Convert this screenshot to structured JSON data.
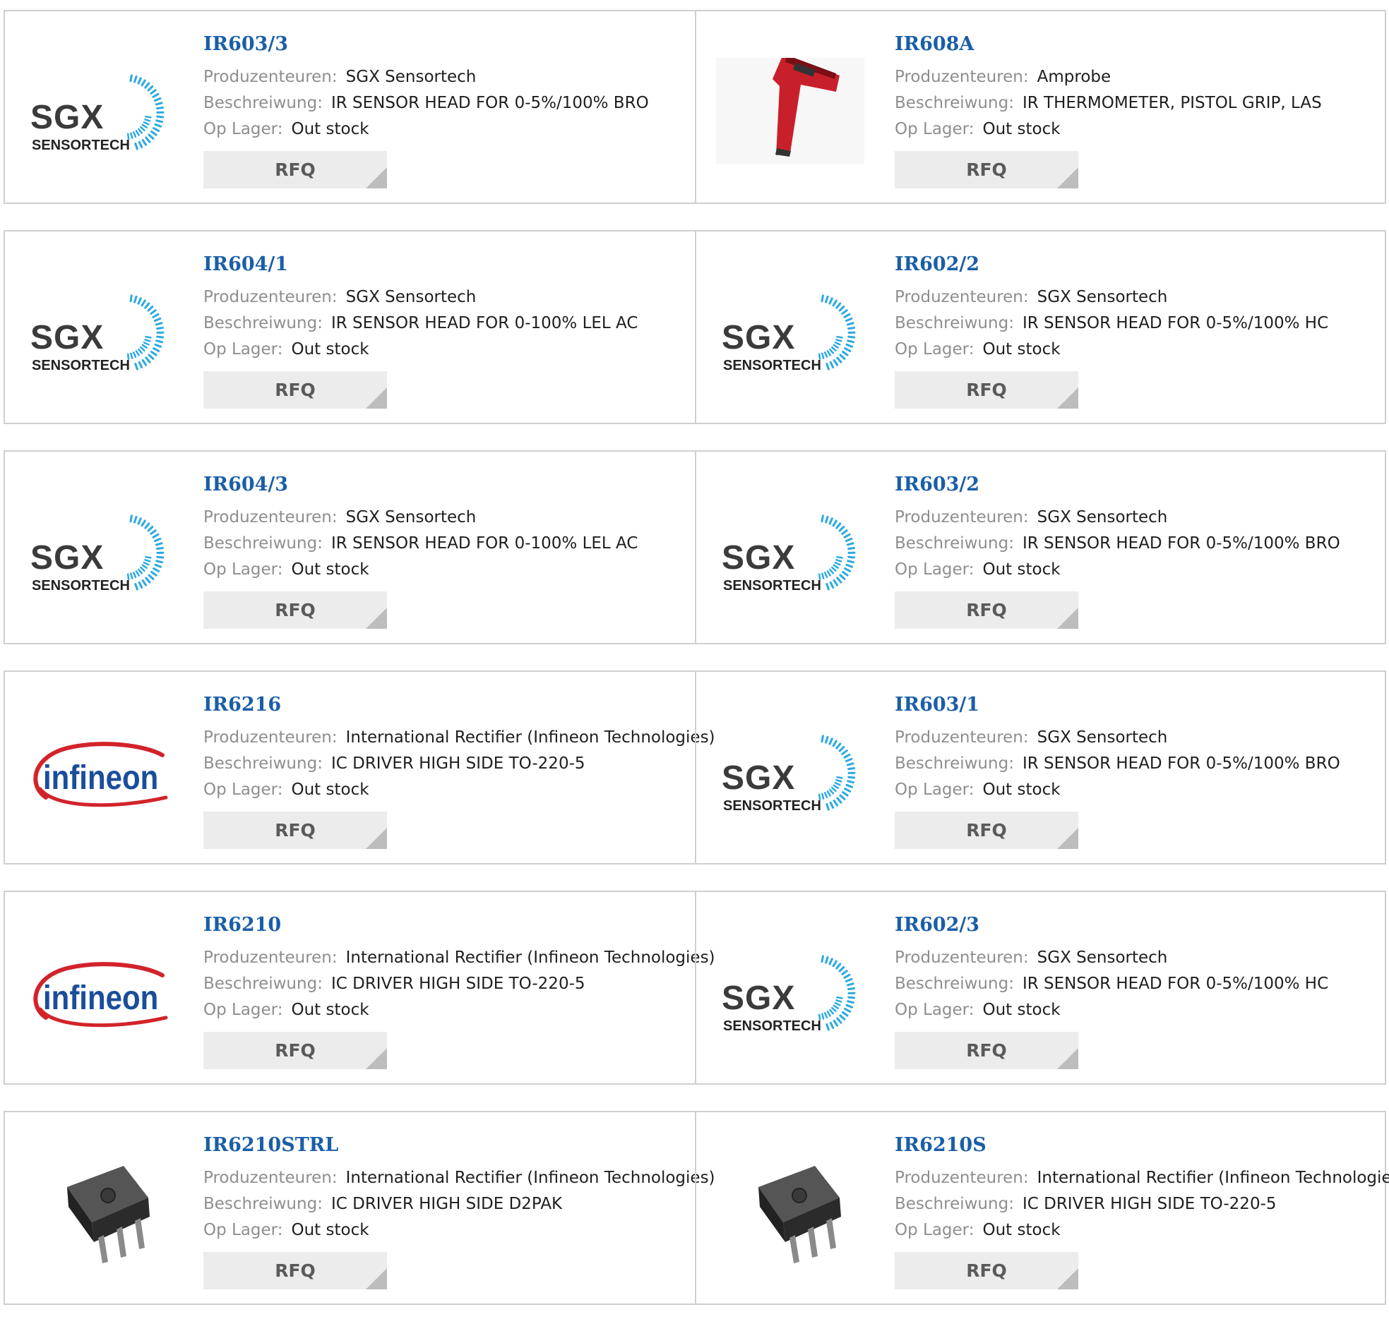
{
  "labels": {
    "manufacturer": "Produzenteuren:",
    "description": "Beschreiwung:",
    "stock": "Op Lager:",
    "rfq": "RFQ"
  },
  "logos": {
    "sgx_line1": "SGX",
    "sgx_line2": "SENSORTECH",
    "infineon": "infineon"
  },
  "colors": {
    "part_number": "#1a5ea8",
    "label_gray": "#8e8e8e",
    "rfq_bg": "#ececec",
    "infineon_red": "#d2232a",
    "infineon_blue": "#1a4d9c",
    "sgx_gray": "#3b3b3b",
    "sgx_cyan": "#2aa9e0"
  },
  "rows": [
    [
      {
        "part": "IR603/3",
        "manufacturer": "SGX Sensortech",
        "description": "IR SENSOR HEAD FOR 0-5%/100% BRO",
        "stock": "Out stock",
        "logo": "sgx-sensortech-logo"
      },
      {
        "part": "IR608A",
        "manufacturer": "Amprobe",
        "description": "IR THERMOMETER, PISTOL GRIP, LAS",
        "stock": "Out stock",
        "logo": "ir-thermometer-photo"
      }
    ],
    [
      {
        "part": "IR604/1",
        "manufacturer": "SGX Sensortech",
        "description": "IR SENSOR HEAD FOR 0-100% LEL AC",
        "stock": "Out stock",
        "logo": "sgx-sensortech-logo"
      },
      {
        "part": "IR602/2",
        "manufacturer": "SGX Sensortech",
        "description": "IR SENSOR HEAD FOR 0-5%/100% HC",
        "stock": "Out stock",
        "logo": "sgx-sensortech-logo"
      }
    ],
    [
      {
        "part": "IR604/3",
        "manufacturer": "SGX Sensortech",
        "description": "IR SENSOR HEAD FOR 0-100% LEL AC",
        "stock": "Out stock",
        "logo": "sgx-sensortech-logo"
      },
      {
        "part": "IR603/2",
        "manufacturer": "SGX Sensortech",
        "description": "IR SENSOR HEAD FOR 0-5%/100% BRO",
        "stock": "Out stock",
        "logo": "sgx-sensortech-logo"
      }
    ],
    [
      {
        "part": "IR6216",
        "manufacturer": "International Rectifier (Infineon Technologies)",
        "description": "IC DRIVER HIGH SIDE TO-220-5",
        "stock": "Out stock",
        "logo": "infineon-logo"
      },
      {
        "part": "IR603/1",
        "manufacturer": "SGX Sensortech",
        "description": "IR SENSOR HEAD FOR 0-5%/100% BRO",
        "stock": "Out stock",
        "logo": "sgx-sensortech-logo"
      }
    ],
    [
      {
        "part": "IR6210",
        "manufacturer": "International Rectifier (Infineon Technologies)",
        "description": "IC DRIVER HIGH SIDE TO-220-5",
        "stock": "Out stock",
        "logo": "infineon-logo"
      },
      {
        "part": "IR602/3",
        "manufacturer": "SGX Sensortech",
        "description": "IR SENSOR HEAD FOR 0-5%/100% HC",
        "stock": "Out stock",
        "logo": "sgx-sensortech-logo"
      }
    ],
    [
      {
        "part": "IR6210STRL",
        "manufacturer": "International Rectifier (Infineon Technologies)",
        "description": "IC DRIVER HIGH SIDE D2PAK",
        "stock": "Out stock",
        "logo": "d2pak-chip-photo"
      },
      {
        "part": "IR6210S",
        "manufacturer": "International Rectifier (Infineon Technologies)",
        "description": "IC DRIVER HIGH SIDE TO-220-5",
        "stock": "Out stock",
        "logo": "d2pak-chip-photo"
      }
    ]
  ]
}
